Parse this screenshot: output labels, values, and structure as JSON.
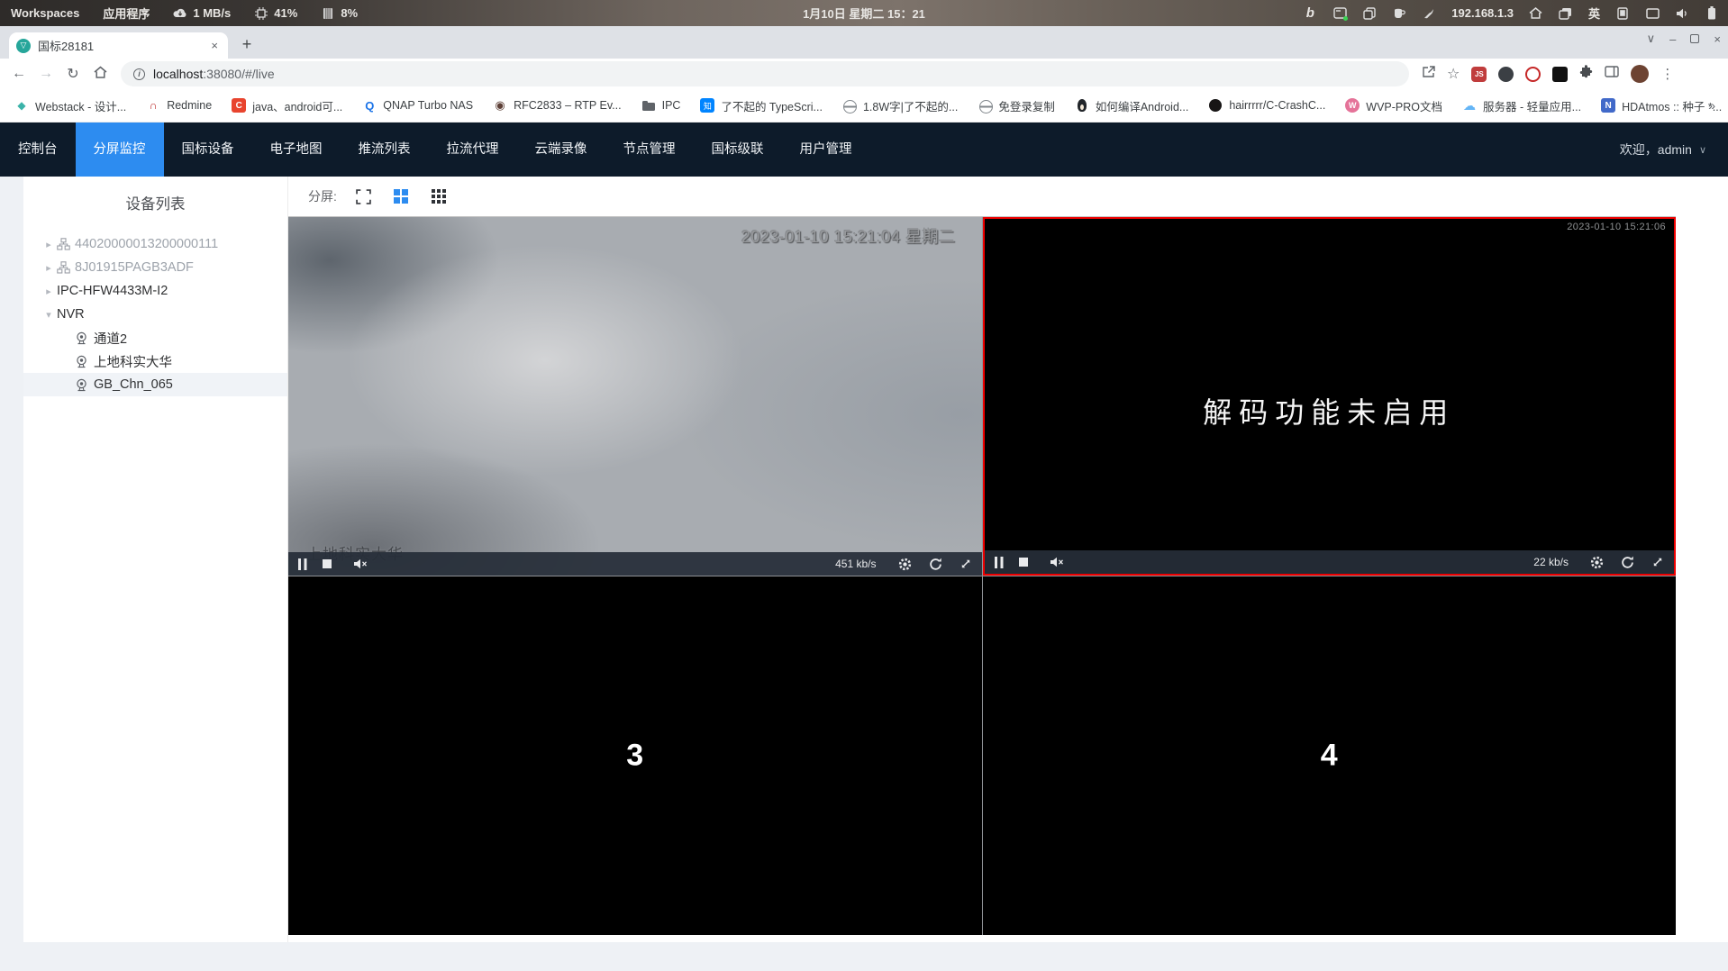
{
  "colors": {
    "accent_blue": "#2d8cf0",
    "nav_bg": "#0d1b2a",
    "selected_red": "#ee0000",
    "tab_favicon": "#26a69a"
  },
  "system_bar": {
    "workspaces": "Workspaces",
    "applications": "应用程序",
    "net_speed": "1 MB/s",
    "cpu_usage": "41%",
    "mem_usage": "8%",
    "datetime": "1月10日 星期二 15：21",
    "ip": "192.168.1.3",
    "input_method": "英",
    "bing": "b"
  },
  "browser": {
    "tab_title": "国标28181",
    "tab_logo": "▽",
    "url": "localhost:38080/#/live",
    "url_host": "localhost",
    "url_path": ":38080/#/live",
    "info_badge": "i",
    "bookmarks": [
      {
        "label": "Webstack - 设计...",
        "glyph": "◆"
      },
      {
        "label": "Redmine",
        "glyph": "∩"
      },
      {
        "label": "java、android可...",
        "glyph": "C"
      },
      {
        "label": "QNAP Turbo NAS",
        "glyph": "Q"
      },
      {
        "label": "RFC2833 – RTP Ev...",
        "glyph": "◉"
      },
      {
        "label": "IPC",
        "glyph": ""
      },
      {
        "label": "了不起的 TypeScri...",
        "glyph": "知"
      },
      {
        "label": "1.8W字|了不起的...",
        "glyph": ""
      },
      {
        "label": "免登录复制",
        "glyph": ""
      },
      {
        "label": "如何编译Android...",
        "glyph": ""
      },
      {
        "label": "hairrrrr/C-CrashC...",
        "glyph": ""
      },
      {
        "label": "WVP-PRO文档",
        "glyph": "W"
      },
      {
        "label": "服务器 - 轻量应用...",
        "glyph": "☁"
      },
      {
        "label": "HDAtmos :: 种子 *...",
        "glyph": "N"
      }
    ],
    "bookmarks_overflow": "»",
    "js_ext": "JS"
  },
  "nav": {
    "items": [
      "控制台",
      "分屏监控",
      "国标设备",
      "电子地图",
      "推流列表",
      "拉流代理",
      "云端录像",
      "节点管理",
      "国标级联",
      "用户管理"
    ],
    "active_index": 1,
    "welcome": "欢迎，admin"
  },
  "sidebar": {
    "title": "设备列表",
    "items": [
      {
        "label": "44020000013200000111",
        "state": "offline"
      },
      {
        "label": "8J01915PAGB3ADF",
        "state": "offline"
      },
      {
        "label": "IPC-HFW4433M-I2",
        "state": "online"
      },
      {
        "label": "NVR",
        "state": "online",
        "expanded": true
      },
      {
        "label": "通道2",
        "parent": "NVR"
      },
      {
        "label": "上地科实大华",
        "parent": "NVR"
      },
      {
        "label": "GB_Chn_065",
        "parent": "NVR",
        "selected": true
      }
    ]
  },
  "toolbar": {
    "split_label": "分屏:"
  },
  "players": {
    "p1": {
      "timestamp": "2023-01-10 15:21:04 星期二",
      "watermark": "上地科实大华",
      "bitrate": "451 kb/s"
    },
    "p2": {
      "message": "解码功能未启用",
      "timestamp": "2023-01-10 15:21:06",
      "bitrate": "22 kb/s",
      "selected": true
    },
    "p3": {
      "number": "3"
    },
    "p4": {
      "number": "4"
    }
  },
  "icons": {
    "back": "←",
    "forward": "→",
    "reload": "↻",
    "star": "☆",
    "menu_dots": "⋮",
    "caret_right": "▸",
    "caret_down": "▾",
    "chevron_down": "∨",
    "window_min": "–",
    "window_close": "×",
    "tab_close": "×",
    "new_tab": "+"
  }
}
